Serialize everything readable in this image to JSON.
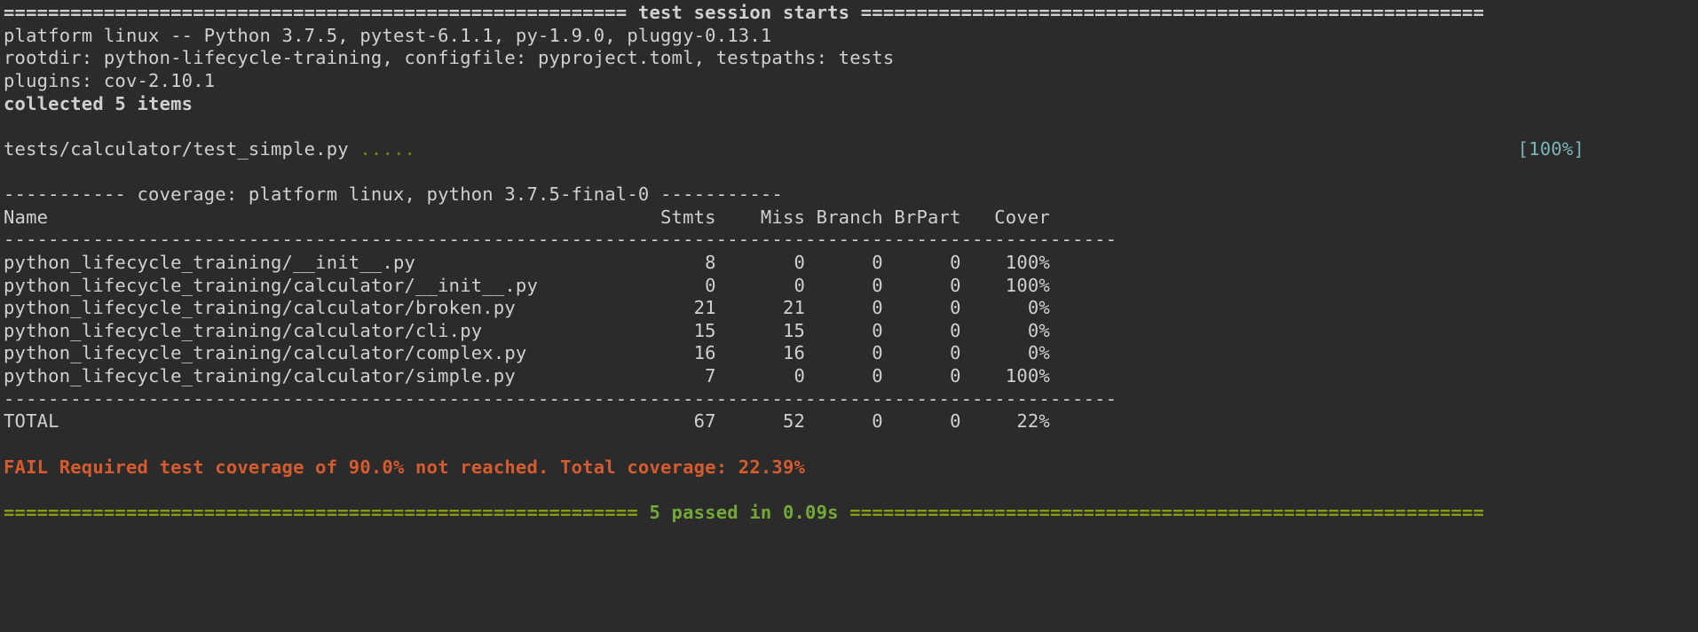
{
  "banner": {
    "eq_left": "======================================================== ",
    "title": "test session starts",
    "eq_right": " ========================================================"
  },
  "platform_line": "platform linux -- Python 3.7.5, pytest-6.1.1, py-1.9.0, pluggy-0.13.1",
  "rootdir_line": "rootdir: python-lifecycle-training, configfile: pyproject.toml, testpaths: tests",
  "plugins_line": "plugins: cov-2.10.1",
  "collected_line": "collected 5 items",
  "test_file": "tests/calculator/test_simple.py ",
  "test_dots": ".....",
  "progress_pct": "[100%]",
  "coverage_header": "----------- coverage: platform linux, python 3.7.5-final-0 -----------",
  "table": {
    "headers": [
      "Name",
      "Stmts",
      "Miss",
      "Branch",
      "BrPart",
      "Cover"
    ],
    "sep": "----------------------------------------------------------------------------------------------------",
    "rows": [
      {
        "name": "python_lifecycle_training/__init__.py",
        "stmts": "8",
        "miss": "0",
        "branch": "0",
        "brpart": "0",
        "cover": "100%"
      },
      {
        "name": "python_lifecycle_training/calculator/__init__.py",
        "stmts": "0",
        "miss": "0",
        "branch": "0",
        "brpart": "0",
        "cover": "100%"
      },
      {
        "name": "python_lifecycle_training/calculator/broken.py",
        "stmts": "21",
        "miss": "21",
        "branch": "0",
        "brpart": "0",
        "cover": "0%"
      },
      {
        "name": "python_lifecycle_training/calculator/cli.py",
        "stmts": "15",
        "miss": "15",
        "branch": "0",
        "brpart": "0",
        "cover": "0%"
      },
      {
        "name": "python_lifecycle_training/calculator/complex.py",
        "stmts": "16",
        "miss": "16",
        "branch": "0",
        "brpart": "0",
        "cover": "0%"
      },
      {
        "name": "python_lifecycle_training/calculator/simple.py",
        "stmts": "7",
        "miss": "0",
        "branch": "0",
        "brpart": "0",
        "cover": "100%"
      }
    ],
    "total": {
      "name": "TOTAL",
      "stmts": "67",
      "miss": "52",
      "branch": "0",
      "brpart": "0",
      "cover": "22%"
    }
  },
  "fail_line": "FAIL Required test coverage of 90.0% not reached. Total coverage: 22.39%",
  "footer": {
    "eq_left": "========================================================= ",
    "passed": "5 passed",
    "in_time": " in 0.09s",
    "eq_right": " ========================================================="
  },
  "cols": {
    "name": 56,
    "stmts": 8,
    "miss": 8,
    "branch": 7,
    "brpart": 7,
    "cover": 8
  }
}
